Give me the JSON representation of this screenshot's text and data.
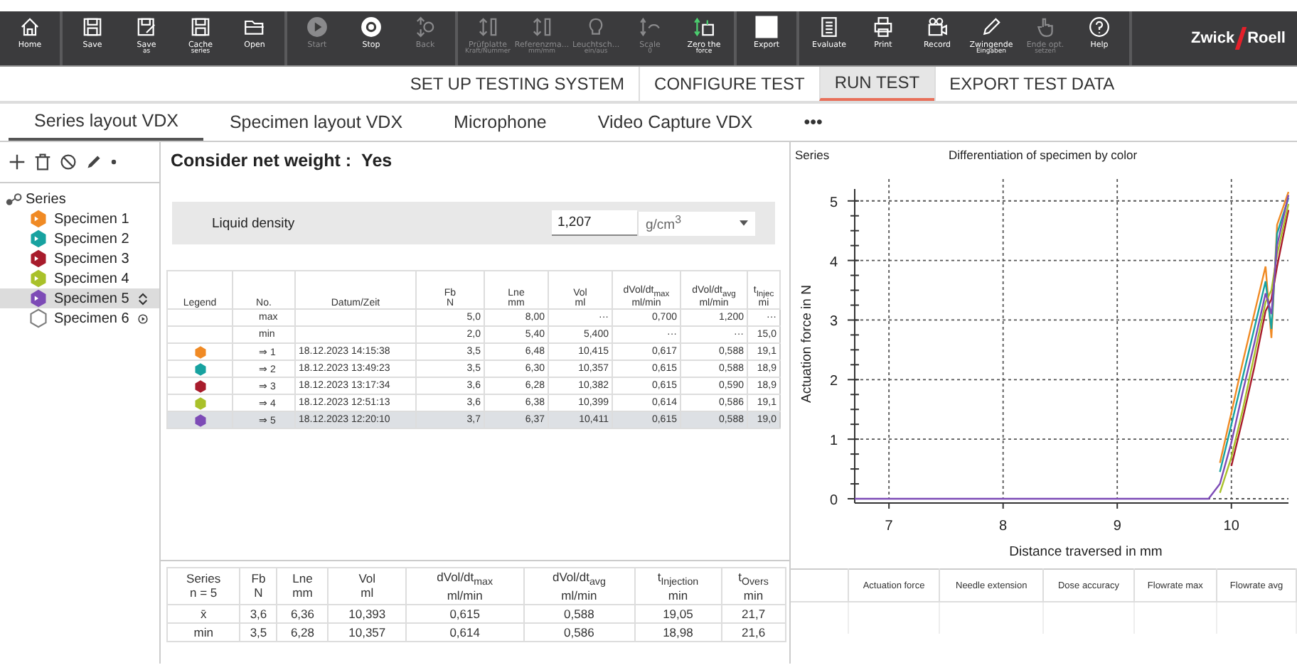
{
  "toolbar": {
    "groups": [
      [
        {
          "kind": "home",
          "label": "Home",
          "disabled": false
        }
      ],
      [
        {
          "kind": "save",
          "label": "Save",
          "disabled": false
        },
        {
          "kind": "save-as",
          "label": "Save",
          "sublabel": "as",
          "disabled": false
        },
        {
          "kind": "cache",
          "label": "Cache",
          "sublabel": "series",
          "disabled": false
        },
        {
          "kind": "open",
          "label": "Open",
          "disabled": false
        }
      ],
      [
        {
          "kind": "start",
          "label": "Start",
          "disabled": true
        },
        {
          "kind": "stop",
          "label": "Stop",
          "disabled": false
        },
        {
          "kind": "back",
          "label": "Back",
          "disabled": true
        }
      ],
      [
        {
          "kind": "plate",
          "label": "Prüfplatte",
          "sublabel": "Kraft/Nummer",
          "disabled": true
        },
        {
          "kind": "reference",
          "label": "Referenzma...",
          "sublabel": "mm/mm",
          "disabled": true
        },
        {
          "kind": "bulb",
          "label": "Leuchtsch...",
          "sublabel": "ein/aus",
          "disabled": true
        },
        {
          "kind": "scale",
          "label": "Scale",
          "sublabel": "0",
          "disabled": true
        },
        {
          "kind": "zero",
          "label": "Zero the",
          "sublabel": "force",
          "disabled": false
        }
      ],
      [
        {
          "kind": "export",
          "label": "Export",
          "disabled": false
        }
      ],
      [
        {
          "kind": "evaluate",
          "label": "Evaluate",
          "disabled": false
        },
        {
          "kind": "print",
          "label": "Print",
          "disabled": false
        },
        {
          "kind": "record",
          "label": "Record",
          "disabled": false
        },
        {
          "kind": "pencil",
          "label": "Zwingende",
          "sublabel": "Eingaben",
          "disabled": false
        },
        {
          "kind": "hand",
          "label": "Ende opt.",
          "sublabel": "setzen",
          "disabled": true
        },
        {
          "kind": "help",
          "label": "Help",
          "disabled": false
        }
      ]
    ],
    "logo": {
      "left": "Zwick",
      "right": "Roell"
    }
  },
  "main_tabs": [
    {
      "label": "SET UP TESTING SYSTEM",
      "selected": false
    },
    {
      "label": "CONFIGURE TEST",
      "selected": false
    },
    {
      "label": "RUN TEST",
      "selected": true
    },
    {
      "label": "EXPORT TEST DATA",
      "selected": false
    }
  ],
  "sub_tabs": [
    {
      "label": "Series layout VDX",
      "selected": true
    },
    {
      "label": "Specimen layout VDX",
      "selected": false
    },
    {
      "label": "Microphone",
      "selected": false
    },
    {
      "label": "Video Capture VDX",
      "selected": false
    },
    {
      "label": "•••",
      "selected": false
    }
  ],
  "tree": {
    "label": "Series",
    "children": [
      {
        "label": "Specimen 1",
        "color": "#f08a24",
        "tested": true,
        "selected": false
      },
      {
        "label": "Specimen 2",
        "color": "#17a2a0",
        "tested": true,
        "selected": false
      },
      {
        "label": "Specimen 3",
        "color": "#a81c2c",
        "tested": true,
        "selected": false
      },
      {
        "label": "Specimen 4",
        "color": "#a9c12a",
        "tested": true,
        "selected": false
      },
      {
        "label": "Specimen 5",
        "color": "#7d4bb6",
        "tested": true,
        "selected": true
      },
      {
        "label": "Specimen 6",
        "color": "#7d7d7d",
        "tested": false,
        "selected": false
      }
    ]
  },
  "net_weight": {
    "label": "Consider net weight :",
    "value": "Yes"
  },
  "liquid_density": {
    "label": "Liquid density",
    "value": "1,207",
    "unit": "g/cm$^{3}$"
  },
  "results_table": {
    "columns": [
      {
        "name": "Legend"
      },
      {
        "name": "No."
      },
      {
        "name": "Datum/Zeit"
      },
      {
        "name": "Fb",
        "unit": "N"
      },
      {
        "name": "Lne",
        "unit": "mm"
      },
      {
        "name": "Vol",
        "unit": "ml"
      },
      {
        "name": "dVol/dt$_{max}$",
        "unit": "ml/min"
      },
      {
        "name": "dVol/dt$_{avg}$",
        "unit": "ml/min"
      },
      {
        "name": "t$_{Injec}$",
        "unit": "mi"
      }
    ],
    "rows": [
      {
        "cells": [
          "",
          "max",
          "",
          "5,0",
          "8,00",
          "···",
          "0,700",
          "1,200",
          "···"
        ],
        "selected": false
      },
      {
        "cells": [
          "",
          "min",
          "",
          "2,0",
          "5,40",
          "5,400",
          "···",
          "···",
          "15,0"
        ],
        "selected": false
      },
      {
        "color": "#f08a24",
        "cells": [
          "",
          "⇒ 1",
          "18.12.2023 14:15:38",
          "3,5",
          "6,48",
          "10,415",
          "0,617",
          "0,588",
          "19,1"
        ],
        "selected": false
      },
      {
        "color": "#17a2a0",
        "cells": [
          "",
          "⇒ 2",
          "18.12.2023 13:49:23",
          "3,5",
          "6,30",
          "10,357",
          "0,615",
          "0,588",
          "18,9"
        ],
        "selected": false
      },
      {
        "color": "#a81c2c",
        "cells": [
          "",
          "⇒ 3",
          "18.12.2023 13:17:34",
          "3,6",
          "6,28",
          "10,382",
          "0,615",
          "0,590",
          "18,9"
        ],
        "selected": false
      },
      {
        "color": "#a9c12a",
        "cells": [
          "",
          "⇒ 4",
          "18.12.2023 12:51:13",
          "3,6",
          "6,38",
          "10,399",
          "0,614",
          "0,586",
          "19,1"
        ],
        "selected": false
      },
      {
        "color": "#7d4bb6",
        "cells": [
          "",
          "⇒ 5",
          "18.12.2023 12:20:10",
          "3,7",
          "6,37",
          "10,411",
          "0,615",
          "0,588",
          "19,0"
        ],
        "selected": true
      }
    ]
  },
  "stats_table": {
    "columns": [
      {
        "name": "Series",
        "unit": "n = 5"
      },
      {
        "name": "Fb",
        "unit": "N"
      },
      {
        "name": "Lne",
        "unit": "mm"
      },
      {
        "name": "Vol",
        "unit": "ml"
      },
      {
        "name": "dVol/dt$_{max}$",
        "unit": "ml/min"
      },
      {
        "name": "dVol/dt$_{avg}$",
        "unit": "ml/min"
      },
      {
        "name": "t$_{Injection}$",
        "unit": "min"
      },
      {
        "name": "t$_{Overs}$",
        "unit": "min"
      }
    ],
    "rows": [
      [
        "x̄",
        "3,6",
        "6,36",
        "10,393",
        "0,615",
        "0,588",
        "19,05",
        "21,7"
      ],
      [
        "min",
        "3,5",
        "6,28",
        "10,357",
        "0,614",
        "0,586",
        "18,98",
        "21,6"
      ]
    ]
  },
  "chart": {
    "label": "Series",
    "chart_data": {
      "type": "line",
      "title": "Differentiation of specimen by color",
      "xlabel": "Distance traversed in mm",
      "ylabel": "Actuation force in N",
      "x": [
        6.7,
        9.8,
        9.9,
        10.0,
        10.1,
        10.2,
        10.3,
        10.35,
        10.4,
        10.5
      ],
      "series": [
        {
          "color": "#f08a24",
          "values": [
            null,
            null,
            0.6,
            1.45,
            2.3,
            3.1,
            3.9,
            2.7,
            4.6,
            5.15
          ]
        },
        {
          "color": "#17a2a0",
          "values": [
            null,
            null,
            0.45,
            1.25,
            2.05,
            2.85,
            3.65,
            2.85,
            4.45,
            5.05
          ]
        },
        {
          "color": "#a81c2c",
          "values": [
            null,
            null,
            null,
            0.55,
            1.35,
            2.2,
            3.15,
            3.35,
            3.9,
            4.85
          ]
        },
        {
          "color": "#a9c12a",
          "values": [
            null,
            null,
            0.1,
            0.7,
            1.5,
            2.4,
            3.3,
            3.5,
            4.1,
            4.95
          ]
        },
        {
          "color": "#7d4bb6",
          "values": [
            0,
            0,
            0.25,
            0.95,
            1.8,
            2.6,
            3.45,
            3.1,
            4.25,
            5.1
          ]
        }
      ],
      "xlim": [
        6.7,
        10.5
      ],
      "ylim": [
        0,
        5.2
      ],
      "xticks": [
        7,
        8,
        9,
        10
      ],
      "yticks": [
        0,
        1,
        2,
        3,
        4,
        5
      ],
      "grid": true
    }
  },
  "results_summary_table": {
    "columns": [
      "Actuation force",
      "Needle extension",
      "Dose accuracy",
      "Flowrate max",
      "Flowrate avg"
    ]
  }
}
